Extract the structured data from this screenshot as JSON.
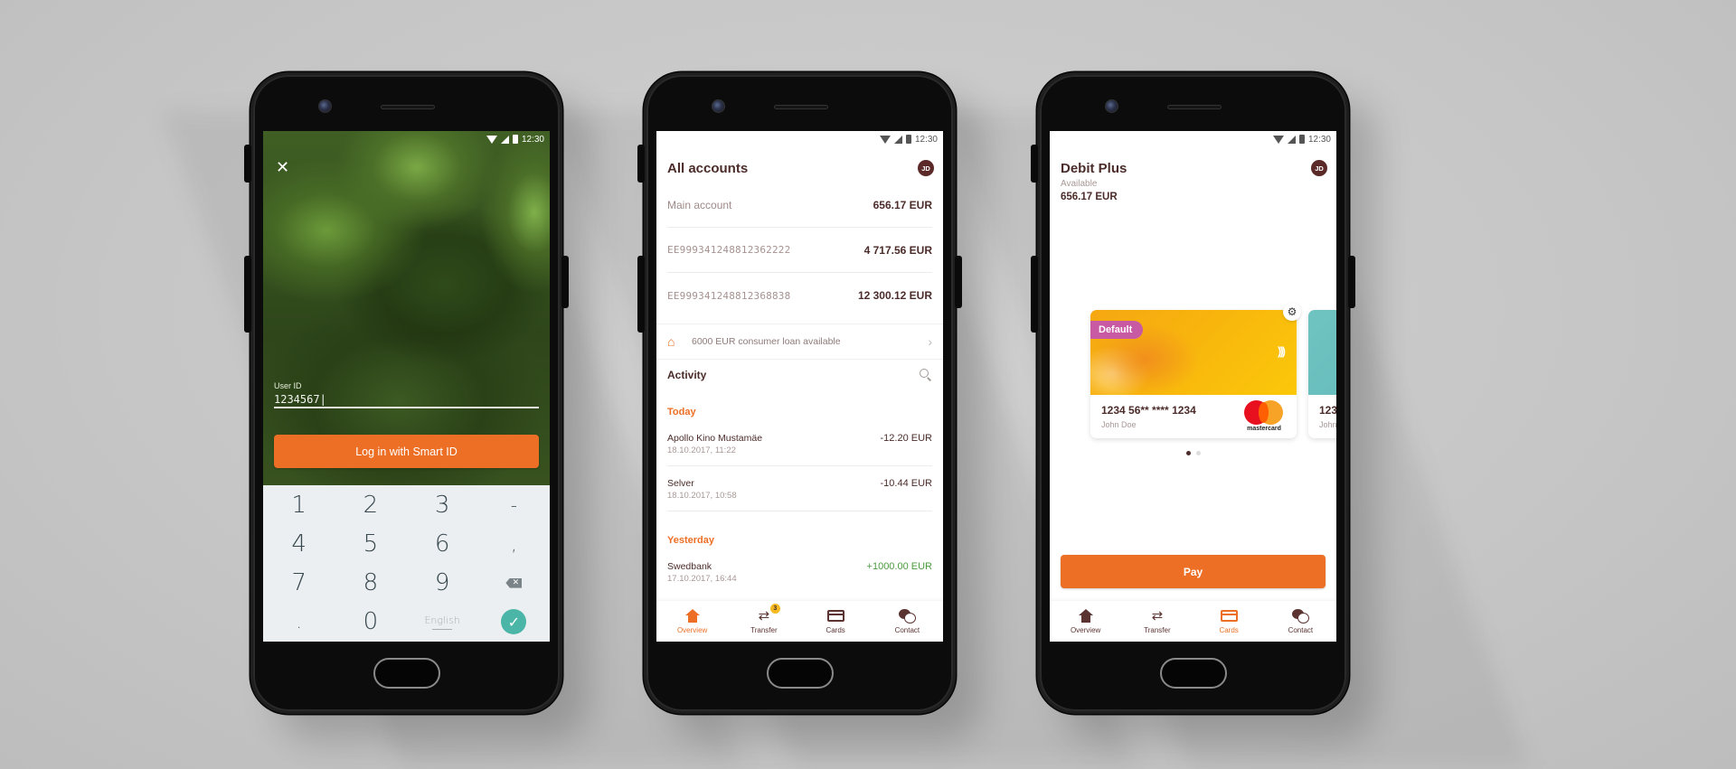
{
  "status_bar": {
    "time": "12:30"
  },
  "login_screen": {
    "close_icon": "close-icon",
    "user_id_label": "User ID",
    "user_id_value": "1234567|",
    "login_button": "Log in with Smart ID",
    "keypad": {
      "keys": [
        "1",
        "2",
        "3",
        "-",
        "4",
        "5",
        "6",
        ",",
        "7",
        "8",
        "9",
        "backspace",
        ".",
        "0",
        "English",
        "done"
      ],
      "language_label": "English"
    }
  },
  "accounts_screen": {
    "title": "All accounts",
    "avatar_initials": "JD",
    "accounts": [
      {
        "name": "Main account",
        "amount": "656.17 EUR"
      },
      {
        "name": "EE999341248812362222",
        "amount": "4 717.56 EUR"
      },
      {
        "name": "EE999341248812368838",
        "amount": "12 300.12 EUR"
      }
    ],
    "loan_banner": "6000 EUR consumer loan available",
    "activity_title": "Activity",
    "groups": [
      {
        "label": "Today",
        "transactions": [
          {
            "name": "Apollo Kino Mustamäe",
            "date": "18.10.2017, 11:22",
            "amount": "-12.20 EUR"
          },
          {
            "name": "Selver",
            "date": "18.10.2017, 10:58",
            "amount": "-10.44 EUR"
          }
        ]
      },
      {
        "label": "Yesterday",
        "transactions": [
          {
            "name": "Swedbank",
            "date": "17.10.2017, 16:44",
            "amount": "+1000.00 EUR"
          }
        ]
      }
    ],
    "nav": [
      {
        "label": "Overview",
        "icon": "home-icon",
        "active": true
      },
      {
        "label": "Transfer",
        "icon": "transfer-icon",
        "badge": "3"
      },
      {
        "label": "Cards",
        "icon": "card-icon"
      },
      {
        "label": "Contact",
        "icon": "chat-icon"
      }
    ]
  },
  "cards_screen": {
    "title": "Debit Plus",
    "avatar_initials": "JD",
    "available_label": "Available",
    "available_amount": "656.17 EUR",
    "cards": [
      {
        "badge": "Default",
        "number": "1234 56** **** 1234",
        "holder": "John Doe",
        "brand": "mastercard"
      },
      {
        "number": "123",
        "holder": "John"
      }
    ],
    "pager": {
      "count": 2,
      "active": 1
    },
    "pay_button": "Pay",
    "nav": [
      {
        "label": "Overview",
        "icon": "home-icon"
      },
      {
        "label": "Transfer",
        "icon": "transfer-icon"
      },
      {
        "label": "Cards",
        "icon": "card-icon",
        "active": true
      },
      {
        "label": "Contact",
        "icon": "chat-icon"
      }
    ]
  },
  "colors": {
    "accent": "#ec6f25",
    "brand_dark": "#4b2c2a",
    "positive": "#4a9a3e",
    "default_badge": "#c75aa3",
    "keypad_done": "#4bb6a8"
  }
}
